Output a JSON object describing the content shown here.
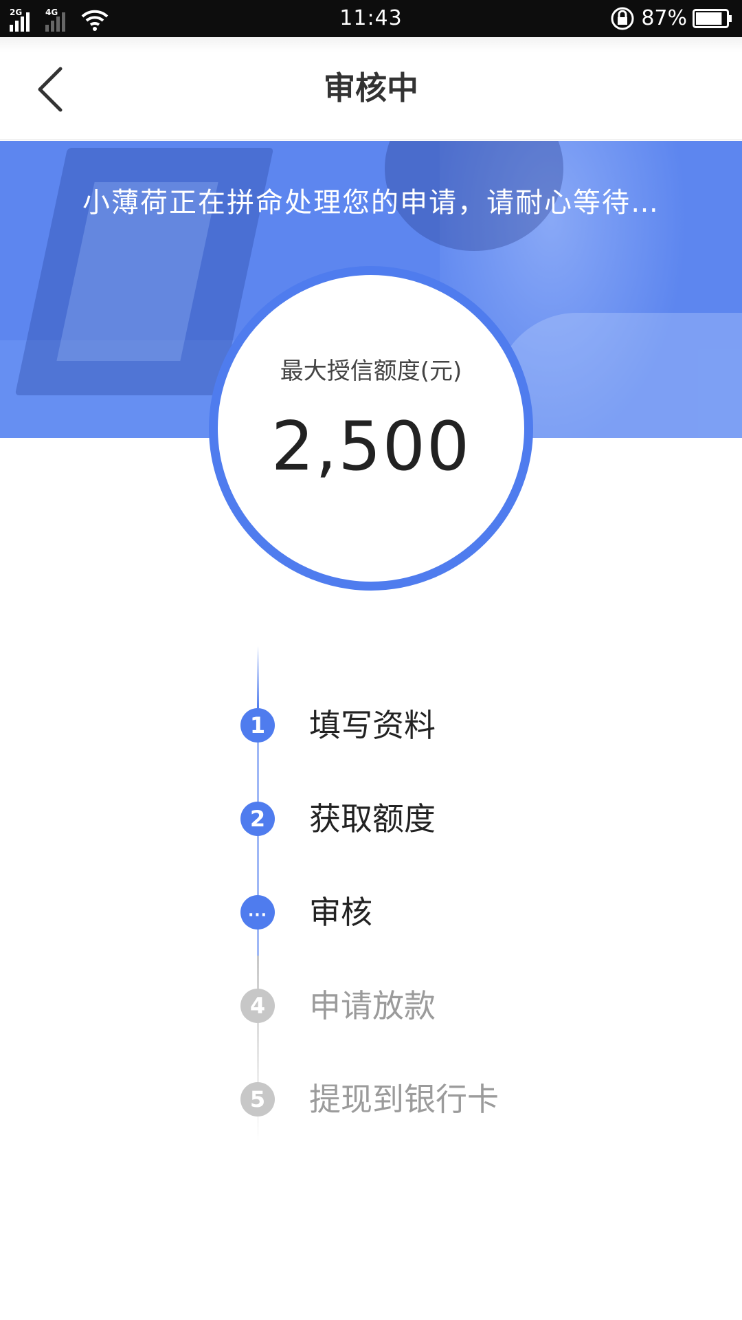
{
  "status_bar": {
    "network1": "2G",
    "network2": "4G",
    "time": "11:43",
    "battery_percent": "87%",
    "battery_level": 0.87
  },
  "nav": {
    "title": "审核中"
  },
  "banner": {
    "message": "小薄荷正在拼命处理您的申请，请耐心等待…"
  },
  "credit": {
    "label": "最大授信额度(元)",
    "amount": "2,500"
  },
  "steps": [
    {
      "number": "1",
      "label": "填写资料",
      "state": "done"
    },
    {
      "number": "2",
      "label": "获取额度",
      "state": "done"
    },
    {
      "number": "···",
      "label": "审核",
      "state": "current"
    },
    {
      "number": "4",
      "label": "申请放款",
      "state": "pending"
    },
    {
      "number": "5",
      "label": "提现到银行卡",
      "state": "pending"
    }
  ],
  "colors": {
    "accent": "#4f7cee",
    "banner": "#5d86ef",
    "pending": "#c7c7c7"
  }
}
